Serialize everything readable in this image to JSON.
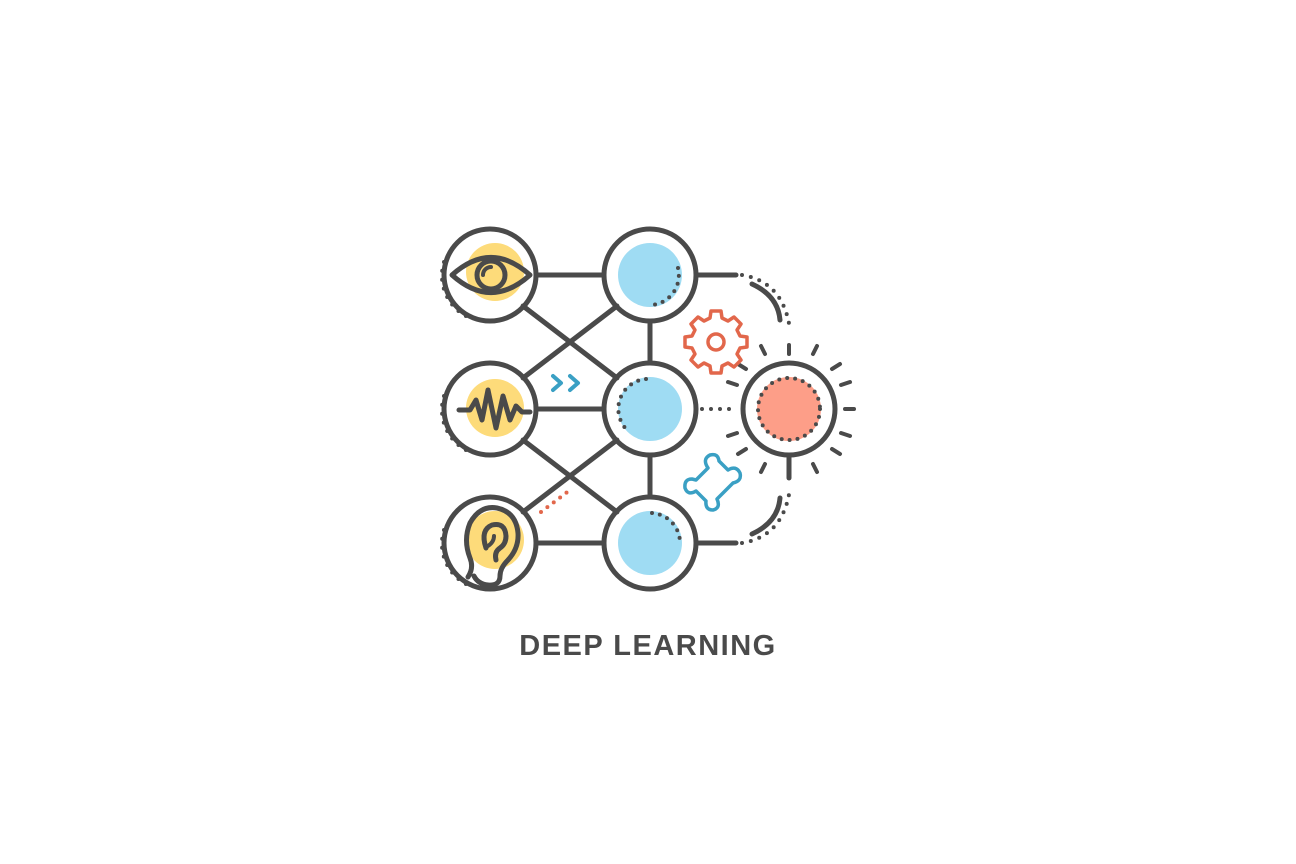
{
  "title": "DEEP LEARNING",
  "colors": {
    "stroke": "#4a4a4a",
    "input_fill": "#fddb7a",
    "hidden_fill": "#9fdcf3",
    "output_fill": "#fd9e88",
    "gear": "#e2674b",
    "puzzle": "#3aa0c4",
    "arrows": "#3aa0c4",
    "dots_accent": "#e2674b"
  },
  "nodes": {
    "inputs": [
      {
        "name": "eye",
        "icon": "eye-icon"
      },
      {
        "name": "sound-wave",
        "icon": "waveform-icon"
      },
      {
        "name": "ear",
        "icon": "ear-icon"
      }
    ],
    "hidden": [
      {
        "name": "hidden-top"
      },
      {
        "name": "hidden-middle"
      },
      {
        "name": "hidden-bottom"
      }
    ],
    "output": {
      "name": "output",
      "icon": "sun-icon"
    }
  },
  "icons": [
    "gear-icon",
    "puzzle-icon",
    "double-chevron-right-icon"
  ]
}
